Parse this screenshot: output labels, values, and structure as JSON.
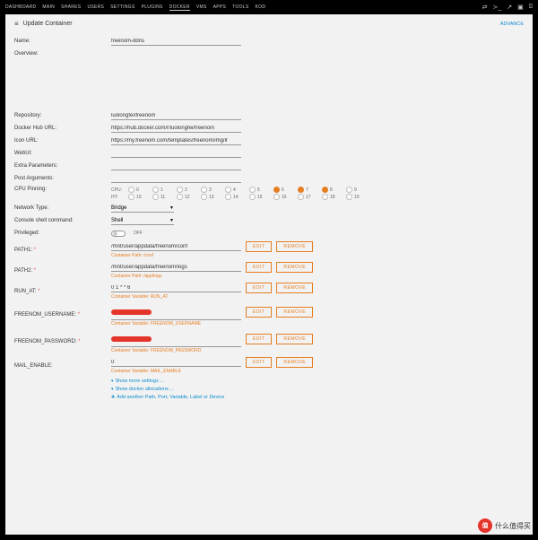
{
  "nav": [
    "DASHBOARD",
    "MAIN",
    "SHARES",
    "USERS",
    "SETTINGS",
    "PLUGINS",
    "DOCKER",
    "VMS",
    "APPS",
    "TOOLS",
    "KOD"
  ],
  "nav_active": 6,
  "page_title": "Update Container",
  "advanced_link": "ADVANCE",
  "labels": {
    "name": "Name:",
    "overview": "Overview:",
    "repository": "Repository:",
    "hub_url": "Docker Hub URL:",
    "icon_url": "Icon URL:",
    "webui": "WebUI:",
    "extra": "Extra Parameters:",
    "post_args": "Post Arguments:",
    "cpu_pinning": "CPU Pinning:",
    "network": "Network Type:",
    "console": "Console shell command:",
    "privileged": "Privileged:",
    "path1": "PATH1:",
    "path2": "PATH2:",
    "run_at": "RUN_AT:",
    "username": "FREENOM_USERNAME:",
    "password": "FREENOM_PASSWORD:",
    "mail": "MAIL_ENABLE:"
  },
  "values": {
    "name": "freenom-ddns",
    "repository": "luolongfei/freenom",
    "hub_url": "https://hub.docker.com/r/luolongfei/freenom",
    "icon_url": "https://my.freenom.com/templates/freenom/img/lr",
    "network": "Bridge",
    "console": "Shell",
    "toggle_off": "OFF",
    "path1": "/mnt/user/appdata/freenom/conf",
    "path1_hint": "Container Path: /conf",
    "path2": "/mnt/user/appdata/freenom/logs",
    "path2_hint": "Container Path: /app/logs",
    "run_at": "0 1 * * 6",
    "run_at_hint": "Container Variable: RUN_AT",
    "username_hint": "Container Variable: FREENOM_USERNAME",
    "password_hint": "Container Variable: FREENOM_PASSWORD",
    "mail": "0",
    "mail_hint": "Container Variable: MAIL_ENABLE"
  },
  "cpu": {
    "row1_label": "CPU:",
    "row2_label": "HT:",
    "row1": [
      0,
      1,
      2,
      3,
      4,
      5,
      6,
      7,
      8,
      9
    ],
    "row2": [
      10,
      11,
      12,
      13,
      14,
      15,
      16,
      17,
      18,
      19
    ],
    "active": [
      6,
      7,
      8
    ]
  },
  "buttons": {
    "edit": "EDIT",
    "remove": "REMOVE"
  },
  "links": {
    "more": "Show more settings ...",
    "alloc": "Show docker allocations ...",
    "add": "Add another Path, Port, Variable, Label or Device"
  },
  "watermark": {
    "icon": "值",
    "text": "什么值得买"
  }
}
